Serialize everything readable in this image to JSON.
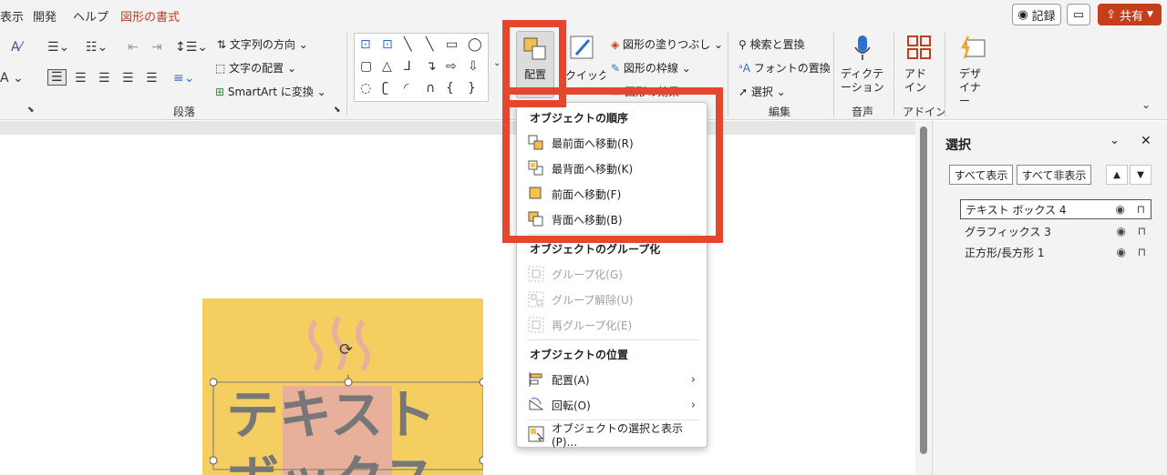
{
  "menu": {
    "tabs": [
      "表示",
      "開発",
      "ヘルプ",
      "図形の書式"
    ],
    "record_label": "記録",
    "share_label": "共有"
  },
  "ribbon": {
    "paragraph_group": "段落",
    "text_direction": "文字列の方向",
    "text_align": "文字の配置",
    "smartart": "SmartArt に変換",
    "arrange_label": "配置",
    "quick_styles": "クイック スタイル",
    "shape_fill": "図形の塗りつぶし",
    "shape_outline": "図形の枠線",
    "shape_effects": "図形の効果",
    "find_replace": "検索と置換",
    "font_replace": "フォントの置換",
    "select": "選択",
    "edit_group": "編集",
    "dictation": "ディクテーション",
    "voice_group": "音声",
    "addins": "アドイン",
    "addins_group": "アドイン",
    "designer": "デザイナー"
  },
  "dropdown": {
    "order_header": "オブジェクトの順序",
    "order_items": [
      "最前面へ移動(R)",
      "最背面へ移動(K)",
      "前面へ移動(F)",
      "背面へ移動(B)"
    ],
    "group_header": "オブジェクトのグループ化",
    "group_items": [
      "グループ化(G)",
      "グループ解除(U)",
      "再グループ化(E)"
    ],
    "position_header": "オブジェクトの位置",
    "position_items": [
      "配置(A)",
      "回転(O)"
    ],
    "selection_pane": "オブジェクトの選択と表示(P)..."
  },
  "pane": {
    "title": "選択",
    "show_all": "すべて表示",
    "hide_all": "すべて非表示",
    "items": [
      "テキスト ボックス 4",
      "グラフィックス 3",
      "正方形/長方形 1"
    ]
  },
  "slide": {
    "text": "テキストボックス"
  },
  "colors": {
    "accent": "#c43e1c",
    "highlight": "#e5462f",
    "slide_rect": "#f5ce62",
    "graphic": "#e8b09a"
  }
}
